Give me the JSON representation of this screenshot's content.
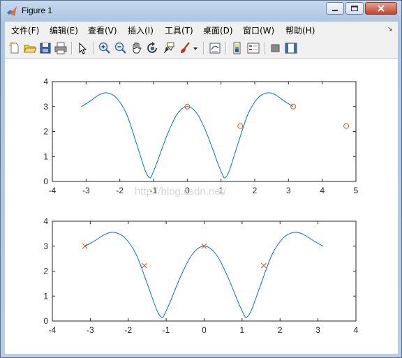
{
  "window": {
    "title": "Figure 1"
  },
  "menu": [
    {
      "label": "文件(F)",
      "icon": ""
    },
    {
      "label": "编辑(E)",
      "icon": ""
    },
    {
      "label": "查看(V)",
      "icon": ""
    },
    {
      "label": "插入(I)",
      "icon": ""
    },
    {
      "label": "工具(T)",
      "icon": ""
    },
    {
      "label": "桌面(D)",
      "icon": ""
    },
    {
      "label": "窗口(W)",
      "icon": ""
    },
    {
      "label": "帮助(H)",
      "icon": ""
    }
  ],
  "toolbar_icons": [
    "new-figure-icon",
    "open-file-icon",
    "save-icon",
    "print-icon",
    "edit-plot-arrow-icon",
    "zoom-in-icon",
    "zoom-out-icon",
    "pan-hand-icon",
    "rotate-3d-icon",
    "data-cursor-icon",
    "brush-icon",
    "link-plot-icon",
    "insert-colorbar-icon",
    "insert-legend-icon",
    "hide-plot-tools-icon",
    "show-plot-tools-icon"
  ],
  "watermark": "http://blog.csdn.net/",
  "colors": {
    "line": "#0072bd",
    "marker": "#d95319",
    "accent": "#3a6ea5"
  },
  "chart_data": [
    {
      "type": "line",
      "title": "",
      "xlabel": "",
      "ylabel": "",
      "xlim": [
        -4,
        5
      ],
      "ylim": [
        0,
        4
      ],
      "xticks": [
        "-4",
        "-3",
        "-2",
        "-1",
        "0",
        "1",
        "2",
        "3",
        "4",
        "5"
      ],
      "yticks": [
        "0",
        "1",
        "2",
        "3",
        "4"
      ],
      "grid": false,
      "series": [
        {
          "kind": "curve",
          "x": [
            -3.14,
            -2.9,
            -2.6,
            -2.36,
            -2.1,
            -1.8,
            -1.5,
            -1.25,
            -1.12,
            -1.05,
            -0.9,
            -0.6,
            -0.3,
            0.0,
            0.3,
            0.6,
            0.9,
            1.05,
            1.12,
            1.25,
            1.5,
            1.8,
            2.1,
            2.36,
            2.6,
            2.9,
            3.14
          ],
          "y": [
            3.0,
            3.2,
            3.48,
            3.55,
            3.35,
            2.7,
            1.5,
            0.45,
            0.15,
            0.25,
            0.75,
            1.85,
            2.7,
            3.0,
            2.7,
            1.85,
            0.75,
            0.25,
            0.15,
            0.45,
            1.5,
            2.7,
            3.35,
            3.55,
            3.48,
            3.2,
            3.0
          ]
        },
        {
          "kind": "markers",
          "marker": "o",
          "x": [
            0,
            1.5708,
            3.1416,
            4.7124
          ],
          "y": [
            3.0,
            2.2214,
            3.0,
            2.2214
          ]
        }
      ]
    },
    {
      "type": "line",
      "title": "",
      "xlabel": "",
      "ylabel": "",
      "xlim": [
        -4,
        4
      ],
      "ylim": [
        0,
        4
      ],
      "xticks": [
        "-4",
        "-3",
        "-2",
        "-1",
        "0",
        "1",
        "2",
        "3",
        "4"
      ],
      "yticks": [
        "0",
        "1",
        "2",
        "3",
        "4"
      ],
      "grid": false,
      "series": [
        {
          "kind": "curve",
          "x": [
            -3.14,
            -2.9,
            -2.6,
            -2.36,
            -2.1,
            -1.8,
            -1.5,
            -1.25,
            -1.12,
            -1.05,
            -0.9,
            -0.6,
            -0.3,
            0.0,
            0.3,
            0.6,
            0.9,
            1.05,
            1.12,
            1.25,
            1.5,
            1.8,
            2.1,
            2.36,
            2.6,
            2.9,
            3.14
          ],
          "y": [
            3.0,
            3.2,
            3.48,
            3.55,
            3.35,
            2.7,
            1.5,
            0.45,
            0.15,
            0.25,
            0.75,
            1.85,
            2.7,
            3.0,
            2.7,
            1.85,
            0.75,
            0.25,
            0.15,
            0.45,
            1.5,
            2.7,
            3.35,
            3.55,
            3.48,
            3.2,
            3.0
          ]
        },
        {
          "kind": "markers",
          "marker": "x",
          "x": [
            -3.1416,
            -1.5708,
            0,
            1.5708
          ],
          "y": [
            3.0,
            2.2214,
            3.0,
            2.2214
          ]
        }
      ]
    }
  ]
}
